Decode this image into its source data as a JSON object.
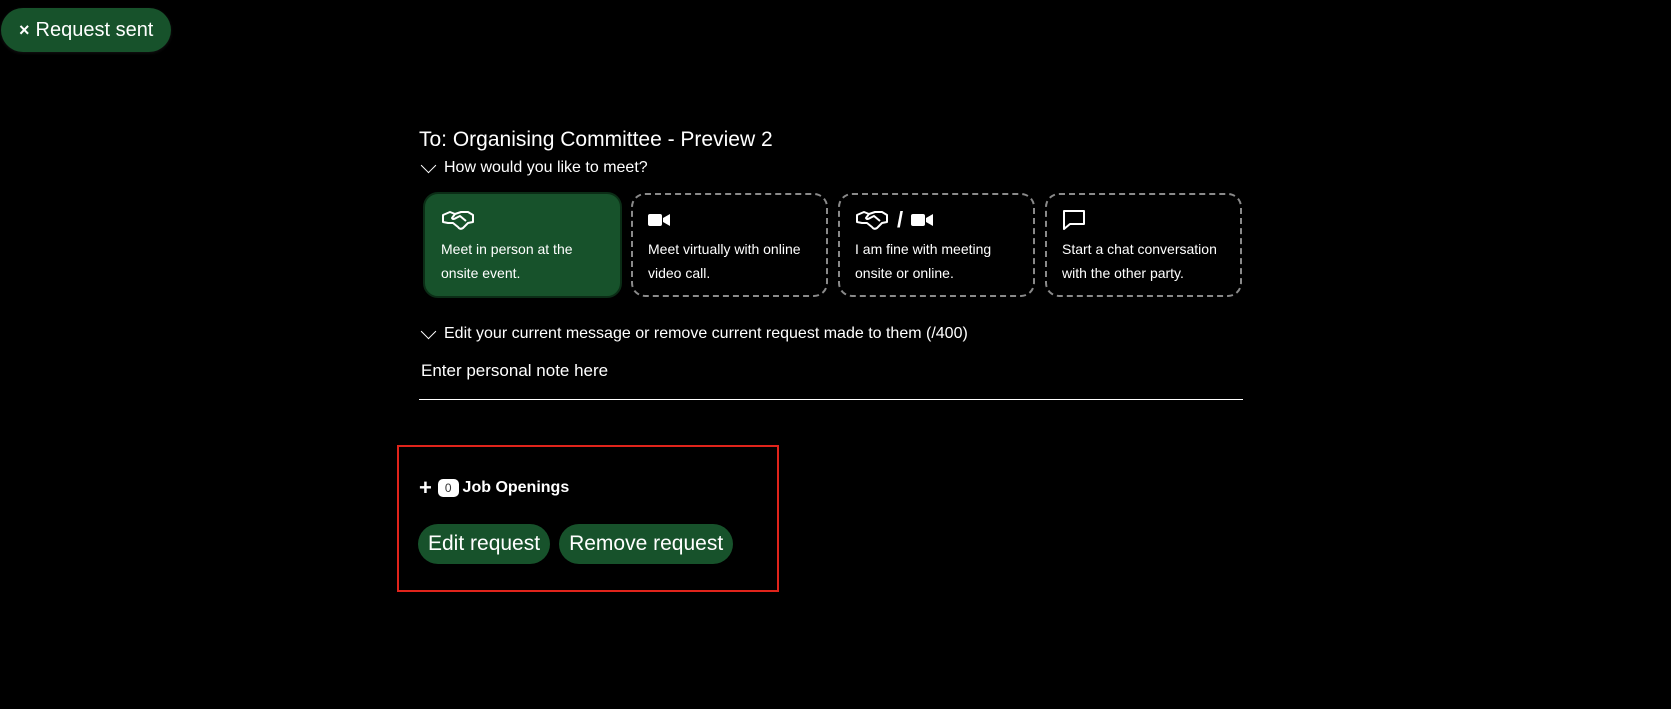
{
  "toast": {
    "label": "Request sent",
    "close_glyph": "×"
  },
  "recipient": "To: Organising Committee - Preview 2",
  "meet_section": {
    "toggle_label": "How would you like to meet?",
    "options": [
      {
        "desc": "Meet in person at the onsite event.",
        "icons": [
          "handshake-icon"
        ],
        "selected": true
      },
      {
        "desc": "Meet virtually with online video call.",
        "icons": [
          "video-camera-icon"
        ],
        "selected": false
      },
      {
        "desc": "I am fine with meeting onsite or online.",
        "icons": [
          "handshake-icon",
          "video-camera-icon"
        ],
        "separator": "/",
        "selected": false
      },
      {
        "desc": "Start a chat conversation with the other party.",
        "icons": [
          "chat-bubble-icon"
        ],
        "selected": false
      }
    ]
  },
  "message_section": {
    "toggle_label": "Edit your current message or remove current request made to them (/400)",
    "note_placeholder": "Enter personal note here"
  },
  "jobs": {
    "plus": "+",
    "count": "0",
    "label": "Job Openings"
  },
  "actions": {
    "edit_label": "Edit request",
    "remove_label": "Remove request"
  },
  "colors": {
    "accent": "#17522b",
    "background": "#000000",
    "highlight": "#e0241b"
  }
}
